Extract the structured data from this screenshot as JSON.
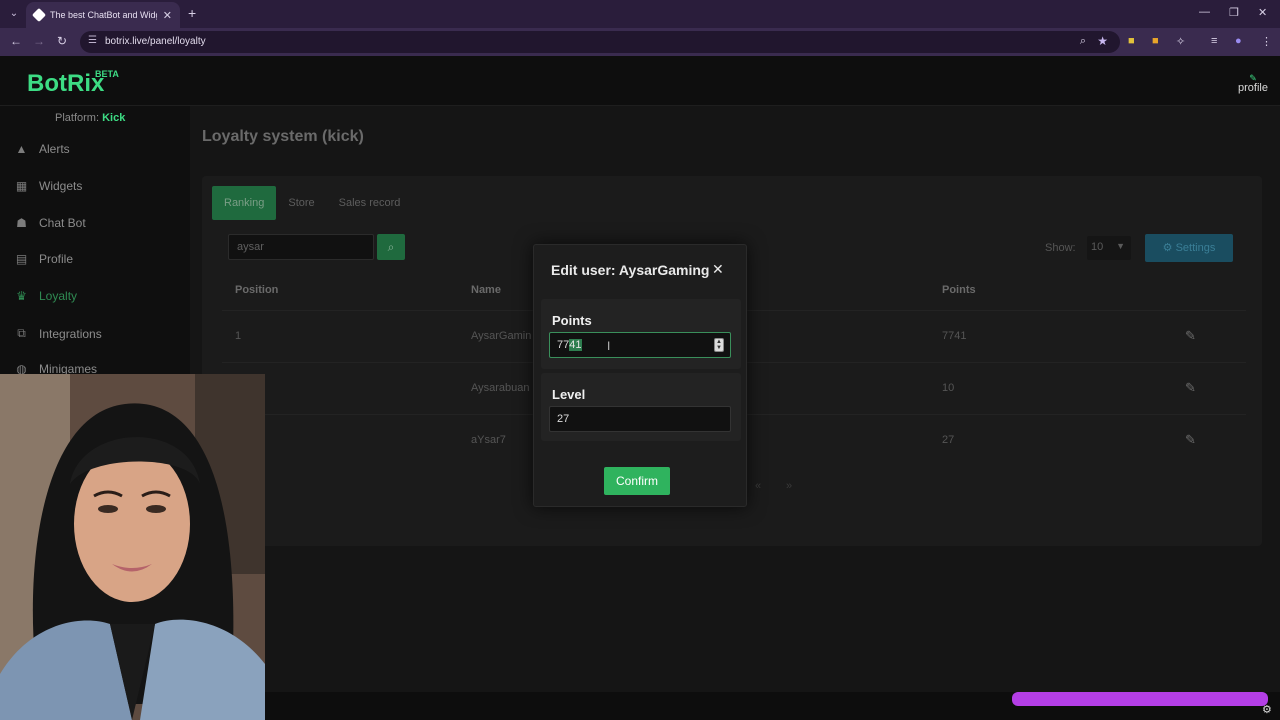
{
  "browser": {
    "tab_title": "The best ChatBot and Widgets",
    "url": "botrix.live/panel/loyalty",
    "icons": [
      "tab-menu-icon",
      "close-icon",
      "new-tab-icon",
      "minimize-icon",
      "restore-icon",
      "window-close-icon",
      "back-icon",
      "forward-icon",
      "reload-icon",
      "site-info-icon",
      "zoom-icon",
      "star-icon",
      "extensions-icon",
      "menu-icon"
    ]
  },
  "topnav": {
    "logo": "BotRix",
    "beta": "BETA",
    "profile_label": "profile"
  },
  "sidebar": {
    "platform_label": "Platform:",
    "platform_value": "Kick",
    "items": [
      {
        "label": "Alerts",
        "icon": "warning-icon"
      },
      {
        "label": "Widgets",
        "icon": "grid-icon"
      },
      {
        "label": "Chat Bot",
        "icon": "robot-icon"
      },
      {
        "label": "Profile",
        "icon": "id-card-icon"
      },
      {
        "label": "Loyalty",
        "icon": "trophy-icon",
        "active": true
      },
      {
        "label": "Integrations",
        "icon": "plug-icon"
      },
      {
        "label": "Minigames",
        "icon": "gamepad-icon"
      }
    ]
  },
  "main": {
    "title": "Loyalty system (kick)",
    "tabs": [
      {
        "label": "Ranking",
        "active": true
      },
      {
        "label": "Store"
      },
      {
        "label": "Sales record"
      }
    ],
    "search_value": "aysar",
    "show_label": "Show:",
    "show_value": "10",
    "settings_label": "Settings",
    "table": {
      "headers": {
        "position": "Position",
        "name": "Name",
        "points": "Points"
      },
      "rows": [
        {
          "position": "1",
          "name": "AysarGamin",
          "points": "7741"
        },
        {
          "position": "",
          "name": "Aysarabuan",
          "points": "10"
        },
        {
          "position": "",
          "name": "aYsar7",
          "points": "27"
        }
      ]
    },
    "pager": [
      "«",
      "»"
    ]
  },
  "modal": {
    "title": "Edit user: AysarGaming",
    "points_label": "Points",
    "points_value_plain": "77",
    "points_value_selected": "41",
    "level_label": "Level",
    "level_value": "27",
    "confirm_label": "Confirm"
  },
  "colors": {
    "brand_green": "#3ddc84",
    "confirm_green": "#2fb35e",
    "settings_blue": "#1a4d60",
    "overlay_purple": "#b43ee6"
  }
}
